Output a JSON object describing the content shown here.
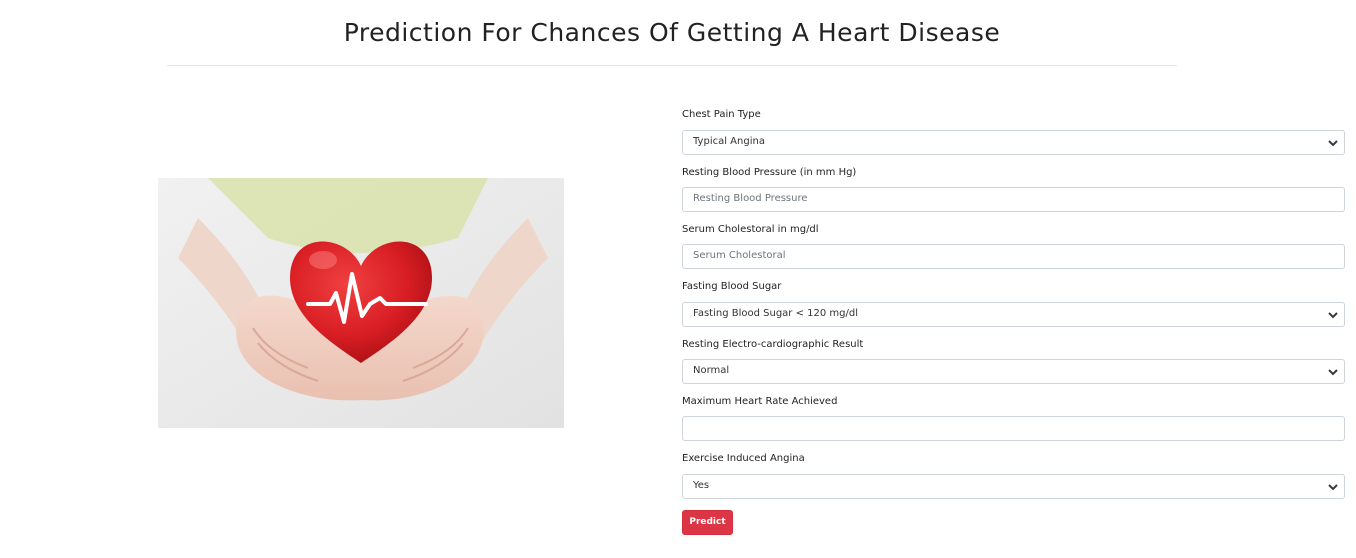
{
  "page": {
    "title": "Prediction For Chances Of Getting A Heart Disease"
  },
  "hero": {
    "image": "heart-in-hands-illustration",
    "colors": {
      "heart": "#d81e24",
      "background": "#ececec",
      "shirt": "#d8e2a8"
    }
  },
  "form": {
    "chest_pain": {
      "label": "Chest Pain Type",
      "selected": "Typical Angina"
    },
    "resting_bp": {
      "label": "Resting Blood Pressure (in mm Hg)",
      "placeholder": "Resting Blood Pressure",
      "value": ""
    },
    "cholesterol": {
      "label": "Serum Cholestoral in mg/dl",
      "placeholder": "Serum Cholestoral",
      "value": ""
    },
    "fasting_sugar": {
      "label": "Fasting Blood Sugar",
      "selected": "Fasting Blood Sugar < 120 mg/dl"
    },
    "ecg": {
      "label": "Resting Electro-cardiographic Result",
      "selected": "Normal"
    },
    "max_heart_rate": {
      "label": "Maximum Heart Rate Achieved",
      "placeholder": "",
      "value": ""
    },
    "exercise_angina": {
      "label": "Exercise Induced Angina",
      "selected": "Yes"
    },
    "predict_label": "Predict",
    "colors": {
      "predict_button": "#dc3545",
      "input_border": "#ced4da"
    }
  }
}
